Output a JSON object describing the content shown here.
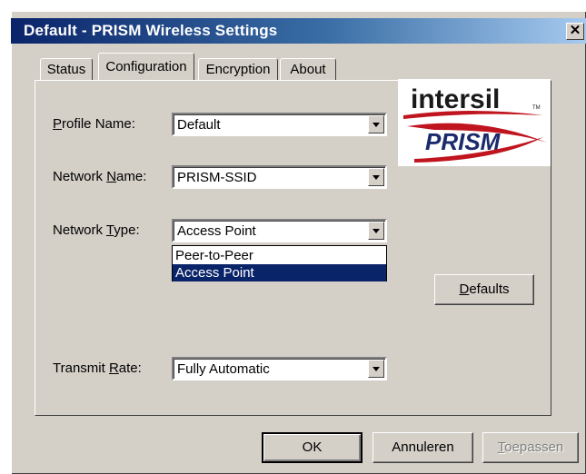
{
  "window": {
    "title": "Default - PRISM Wireless Settings",
    "close_glyph": "✕"
  },
  "tabs": [
    {
      "label": "Status",
      "active": false
    },
    {
      "label": "Configuration",
      "active": true
    },
    {
      "label": "Encryption",
      "active": false
    },
    {
      "label": "About",
      "active": false
    }
  ],
  "fields": {
    "profile_name": {
      "label_prefix": "",
      "label_accel": "P",
      "label_rest": "rofile Name:",
      "value": "Default"
    },
    "network_name": {
      "label_prefix": "Network ",
      "label_accel": "N",
      "label_rest": "ame:",
      "value": "PRISM-SSID"
    },
    "network_type": {
      "label_prefix": "Network ",
      "label_accel": "T",
      "label_rest": "ype:",
      "value": "Access Point",
      "options": [
        "Peer-to-Peer",
        "Access Point"
      ],
      "selected_index": 1
    },
    "transmit_rate": {
      "label_prefix": "Transmit ",
      "label_accel": "R",
      "label_rest": "ate:",
      "value": "Fully Automatic"
    }
  },
  "logo": {
    "brand_top": "intersil",
    "trademark": "TM",
    "brand_bottom": "PRISM",
    "colors": {
      "dark": "#1a1a1a",
      "red": "#c0141e",
      "navy": "#1a2a6c"
    }
  },
  "buttons": {
    "defaults": {
      "accel": "D",
      "rest": "efaults"
    },
    "ok": "OK",
    "cancel": "Annuleren",
    "apply": {
      "accel": "T",
      "rest": "oepassen",
      "enabled": false
    }
  },
  "colors": {
    "face": "#d4d0c8",
    "title_start": "#0a246a",
    "title_end": "#a6caf0",
    "selection": "#0a246a"
  }
}
